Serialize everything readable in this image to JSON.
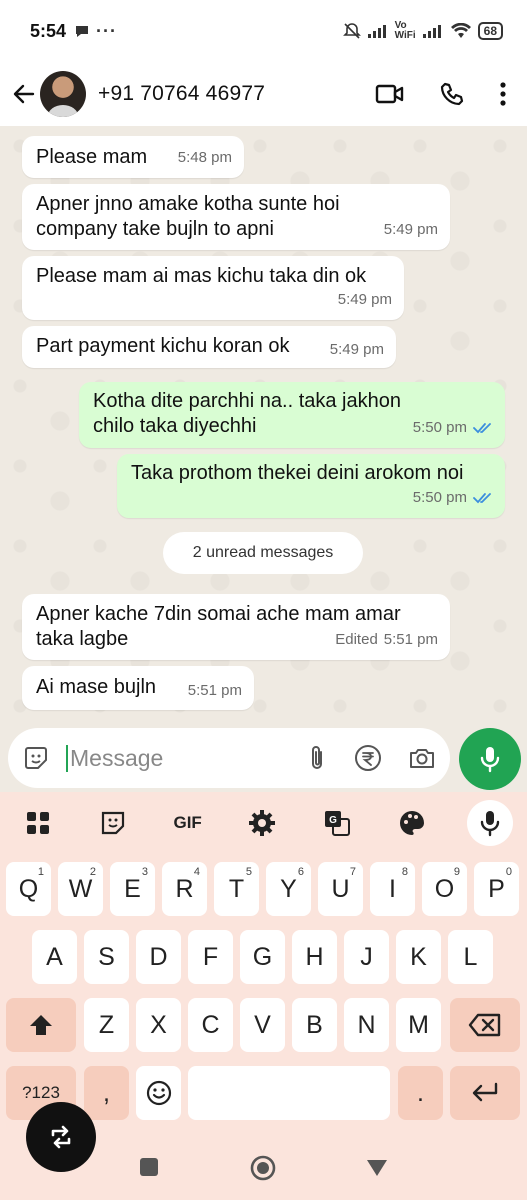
{
  "status_bar": {
    "time": "5:54",
    "battery": "68",
    "network_label": "Vo\nWiFi"
  },
  "header": {
    "contact": "+91 70764 46977"
  },
  "messages": [
    {
      "dir": "in",
      "text": "Please mam",
      "time": "5:48 pm"
    },
    {
      "dir": "in",
      "text": "Apner jnno amake kotha sunte hoi company take bujln to apni",
      "time": "5:49 pm"
    },
    {
      "dir": "in",
      "text": "Please mam ai mas kichu taka din ok",
      "time": "5:49 pm"
    },
    {
      "dir": "in",
      "text": "Part payment kichu koran ok",
      "time": "5:49 pm"
    },
    {
      "dir": "out",
      "text": "Kotha dite parchhi na.. taka jakhon chilo taka diyechhi",
      "time": "5:50 pm"
    },
    {
      "dir": "out",
      "text": "Taka prothom thekei deini arokom noi",
      "time": "5:50 pm"
    },
    {
      "dir": "in",
      "text": "Apner kache 7din somai ache mam amar taka lagbe",
      "time": "5:51 pm",
      "edited": "Edited"
    },
    {
      "dir": "in",
      "text": "Ai mase bujln",
      "time": "5:51 pm"
    }
  ],
  "unread_label": "2 unread messages",
  "input": {
    "placeholder": "Message"
  },
  "keyboard": {
    "toolbar_gif": "GIF",
    "row1": [
      "Q",
      "W",
      "E",
      "R",
      "T",
      "Y",
      "U",
      "I",
      "O",
      "P"
    ],
    "row1_hints": [
      "1",
      "2",
      "3",
      "4",
      "5",
      "6",
      "7",
      "8",
      "9",
      "0"
    ],
    "row2": [
      "A",
      "S",
      "D",
      "F",
      "G",
      "H",
      "J",
      "K",
      "L"
    ],
    "row3": [
      "Z",
      "X",
      "C",
      "V",
      "B",
      "N",
      "M"
    ],
    "symbols": "?123",
    "comma": ",",
    "period": "."
  },
  "colors": {
    "chat_bg": "#efeae2",
    "outgoing": "#d9fdd3",
    "accent": "#21a453",
    "keyboard_bg": "#fbe4dc"
  }
}
